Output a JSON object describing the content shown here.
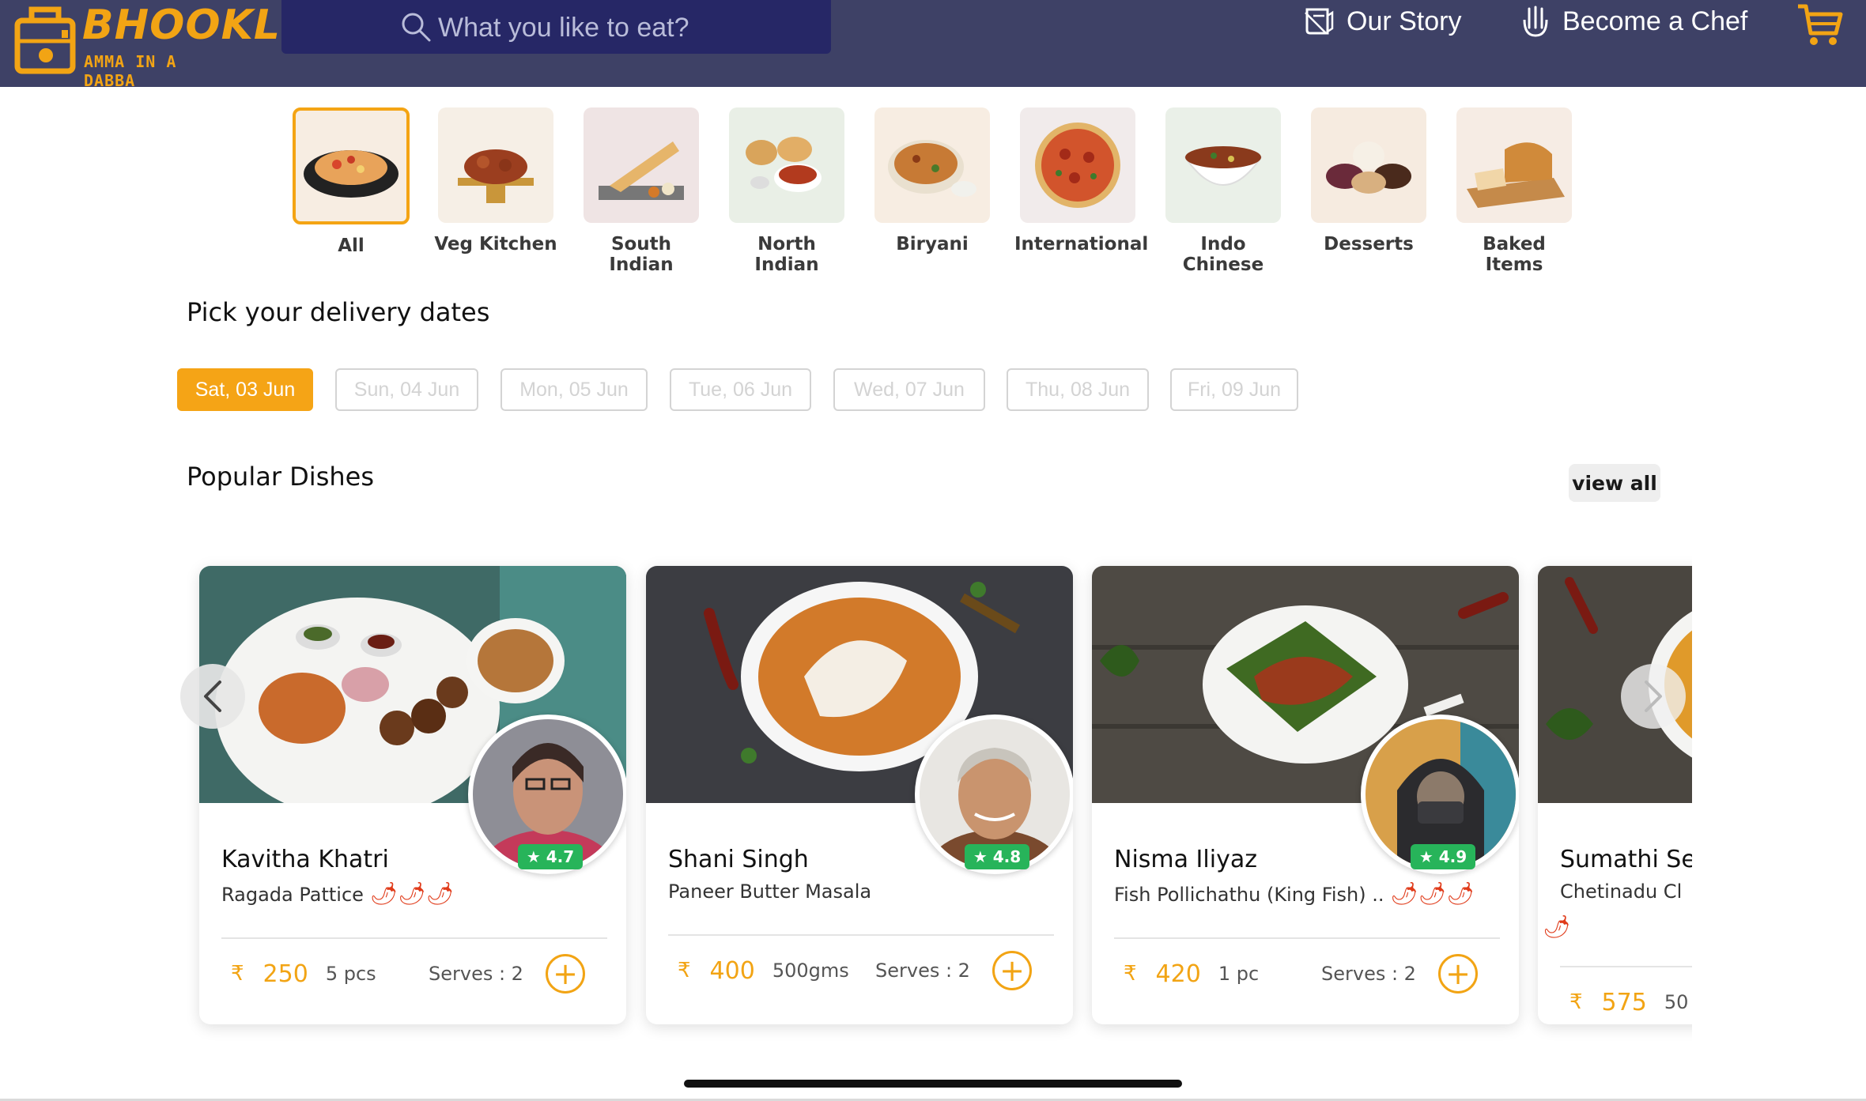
{
  "brand": {
    "name": "BHOOKLE",
    "tagline": "AMMA IN A DABBA",
    "color": "#f2a414"
  },
  "header": {
    "search_placeholder": "What you like to eat?",
    "nav": [
      {
        "label": "Our Story",
        "icon": "story-icon"
      },
      {
        "label": "Become a Chef",
        "icon": "chef-hand-icon"
      }
    ],
    "cart_icon": "cart-icon"
  },
  "categories": [
    {
      "label": "All",
      "active": true
    },
    {
      "label": "Veg Kitchen"
    },
    {
      "label": "South Indian"
    },
    {
      "label": "North Indian"
    },
    {
      "label": "Biryani"
    },
    {
      "label": "International"
    },
    {
      "label": "Indo Chinese"
    },
    {
      "label": "Desserts"
    },
    {
      "label": "Baked Items"
    }
  ],
  "delivery": {
    "heading": "Pick your delivery dates",
    "dates": [
      "Sat, 03 Jun",
      "Sun, 04 Jun",
      "Mon, 05 Jun",
      "Tue, 06 Jun",
      "Wed, 07 Jun",
      "Thu, 08 Jun",
      "Fri, 09 Jun"
    ],
    "selected": "Sat, 03 Jun"
  },
  "popular": {
    "heading": "Popular Dishes",
    "view_all": "view all",
    "currency": "₹",
    "dishes": [
      {
        "chef": "Kavitha Khatri",
        "dish": "Ragada Pattice",
        "rating": "★ 4.7",
        "spice": 3,
        "price": "250",
        "qty": "5 pcs",
        "serves": "Serves : 2"
      },
      {
        "chef": "Shani Singh",
        "dish": "Paneer Butter Masala",
        "rating": "★ 4.8",
        "spice": 0,
        "price": "400",
        "qty": "500gms",
        "serves": "Serves : 2"
      },
      {
        "chef": "Nisma Iliyaz",
        "dish": "Fish Pollichathu (King Fish) ..",
        "rating": "★ 4.9",
        "spice": 3,
        "price": "420",
        "qty": "1 pc",
        "serves": "Serves : 2"
      },
      {
        "chef": "Sumathi Se",
        "dish": "Chetinadu Cl",
        "rating": "",
        "spice": 1,
        "price": "575",
        "qty": "50",
        "serves": ""
      }
    ]
  }
}
